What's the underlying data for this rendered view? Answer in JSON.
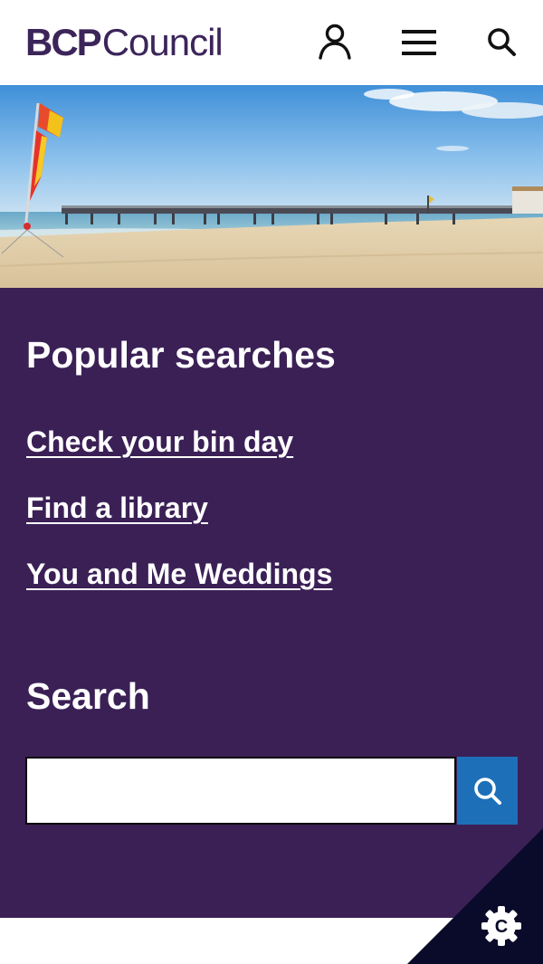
{
  "header": {
    "logo_bold": "BCP",
    "logo_regular": "Council",
    "account_icon": "person-icon",
    "menu_icon": "hamburger-menu-icon",
    "search_icon": "search-icon"
  },
  "hero": {
    "image": "beach-pier-with-lifeguard-flags"
  },
  "popular": {
    "title": "Popular searches",
    "links": [
      "Check your bin day",
      "Find a library",
      "You and Me Weddings"
    ]
  },
  "search": {
    "title": "Search",
    "value": "",
    "placeholder": "",
    "button_icon": "search-icon"
  },
  "cookie": {
    "icon": "cookie-settings-icon",
    "label": "C"
  },
  "colors": {
    "brand_purple": "#3b2056",
    "logo_purple": "#3b2559",
    "search_button_blue": "#1d70b8",
    "cookie_corner_navy": "#0a0a2a"
  }
}
